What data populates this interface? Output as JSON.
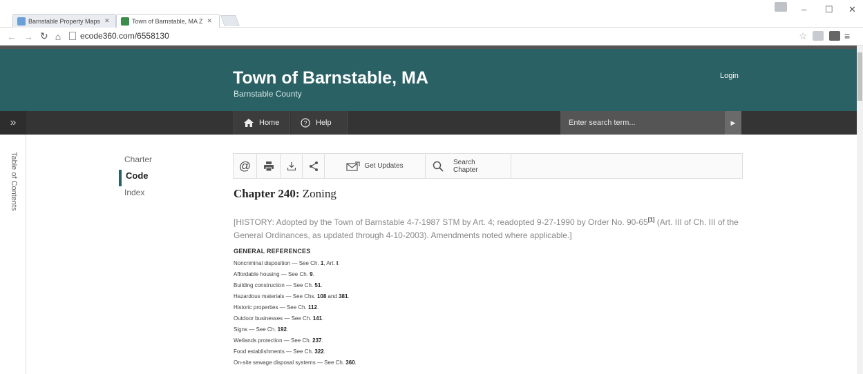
{
  "browser": {
    "tabs": [
      {
        "label": "Barnstable Property Maps",
        "active": false
      },
      {
        "label": "Town of Barnstable, MA Z",
        "active": true
      }
    ],
    "url": "ecode360.com/6558130"
  },
  "site": {
    "title": "Town of Barnstable, MA",
    "subtitle": "Barnstable County",
    "login": "Login",
    "accent": "#2a6164"
  },
  "nav": {
    "home": "Home",
    "help": "Help",
    "search_placeholder": "Enter search term..."
  },
  "toc_label": "Table of Contents",
  "sidenav": [
    "Charter",
    "Code",
    "Index"
  ],
  "toolbar": {
    "get_updates": "Get Updates",
    "search_chapter_1": "Search",
    "search_chapter_2": "Chapter"
  },
  "chapter": {
    "prefix": "Chapter 240:",
    "name": "Zoning"
  },
  "history": {
    "text1": "[HISTORY: Adopted by the Town of Barnstable 4-7-1987 STM by Art. 4; readopted 9-27-1990 by Order No. 90-65",
    "footnote": "[1]",
    "text2": " (Art. III of Ch. III of the General Ordinances, as updated through 4-10-2003). Amendments noted where applicable.]"
  },
  "general_references": {
    "heading": "GENERAL REFERENCES",
    "items": [
      {
        "text": "Noncriminal disposition — See Ch. ",
        "ref": "1",
        "extra": ", Art. ",
        "ref2": "I",
        "end": "."
      },
      {
        "text": "Affordable housing — See Ch. ",
        "ref": "9",
        "extra": "",
        "ref2": "",
        "end": "."
      },
      {
        "text": "Building construction — See Ch. ",
        "ref": "51",
        "extra": "",
        "ref2": "",
        "end": "."
      },
      {
        "text": "Hazardous materials — See Chs. ",
        "ref": "108",
        "extra": " and ",
        "ref2": "381",
        "end": "."
      },
      {
        "text": "Historic properties — See Ch. ",
        "ref": "112",
        "extra": "",
        "ref2": "",
        "end": "."
      },
      {
        "text": "Outdoor businesses — See Ch. ",
        "ref": "141",
        "extra": "",
        "ref2": "",
        "end": "."
      },
      {
        "text": "Signs — See Ch. ",
        "ref": "192",
        "extra": "",
        "ref2": "",
        "end": "."
      },
      {
        "text": "Wetlands protection — See Ch. ",
        "ref": "237",
        "extra": "",
        "ref2": "",
        "end": "."
      },
      {
        "text": "Food establishments — See Ch. ",
        "ref": "322",
        "extra": "",
        "ref2": "",
        "end": "."
      },
      {
        "text": "On-site sewage disposal systems — See Ch. ",
        "ref": "360",
        "extra": "",
        "ref2": "",
        "end": "."
      }
    ]
  }
}
